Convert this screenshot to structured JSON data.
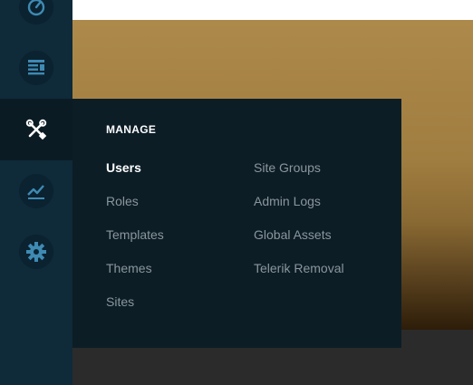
{
  "sidebar": {
    "items": [
      {
        "icon": "dashboard-icon"
      },
      {
        "icon": "content-icon"
      },
      {
        "icon": "tools-icon",
        "active": true
      },
      {
        "icon": "analytics-icon"
      },
      {
        "icon": "settings-icon"
      }
    ]
  },
  "flyout": {
    "title": "MANAGE",
    "col1": [
      "Users",
      "Roles",
      "Templates",
      "Themes",
      "Sites"
    ],
    "col2": [
      "Site Groups",
      "Admin Logs",
      "Global Assets",
      "Telerik Removal"
    ],
    "active_item": "Users"
  },
  "colors": {
    "sidebar_bg": "#0f2a39",
    "icon_color": "#3e8ab3",
    "flyout_bg": "#0c1d26",
    "active_text": "#ffffff",
    "muted_text": "#8b969c"
  }
}
